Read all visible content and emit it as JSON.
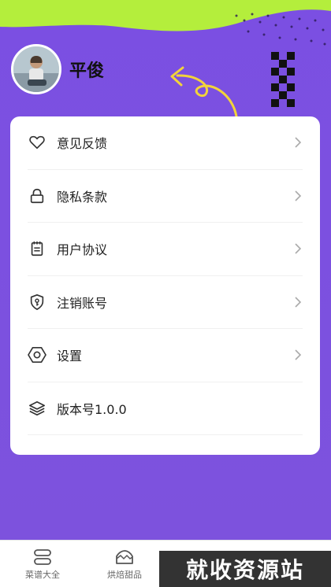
{
  "user": {
    "name": "平俊"
  },
  "menu": [
    {
      "icon": "heart-icon",
      "label": "意见反馈"
    },
    {
      "icon": "lock-icon",
      "label": "隐私条款"
    },
    {
      "icon": "document-icon",
      "label": "用户协议"
    },
    {
      "icon": "shield-key-icon",
      "label": "注销账号"
    },
    {
      "icon": "hexagon-settings-icon",
      "label": "设置"
    },
    {
      "icon": "layers-icon",
      "label": "版本号1.0.0"
    }
  ],
  "tabs": [
    {
      "icon": "recipe-list-icon",
      "label": "菜谱大全"
    },
    {
      "icon": "cake-icon",
      "label": "烘焙甜品"
    }
  ],
  "watermark": "就收资源站",
  "colors": {
    "accent": "#7b4fe2",
    "lime": "#b4ee3c",
    "arrow": "#f2d33a"
  }
}
